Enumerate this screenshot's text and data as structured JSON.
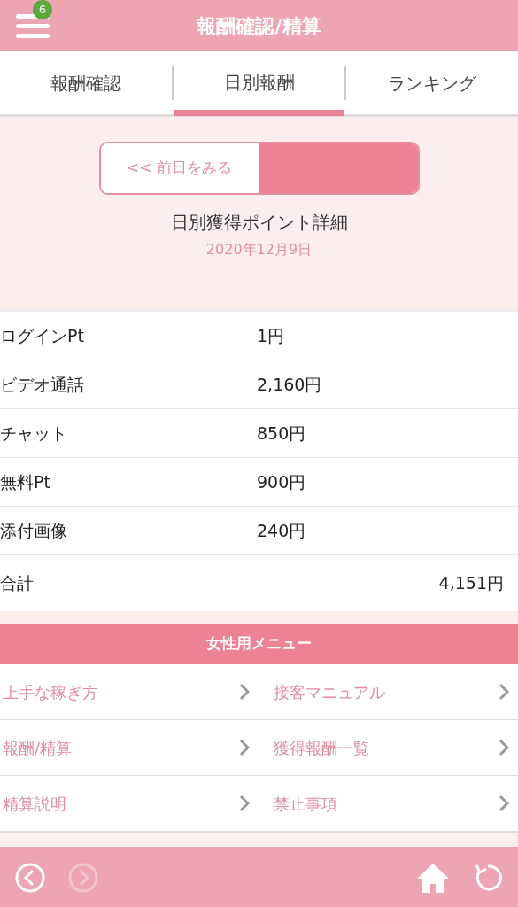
{
  "header": {
    "title": "報酬確認/精算",
    "badge": "6"
  },
  "tabs": [
    {
      "label": "報酬確認",
      "selected": false
    },
    {
      "label": "日別報酬",
      "selected": true
    },
    {
      "label": "ランキング",
      "selected": false
    }
  ],
  "day_nav": {
    "prev_label": "<< 前日をみる",
    "next_disabled": true
  },
  "detail": {
    "title": "日別獲得ポイント詳細",
    "date": "2020年12月9日"
  },
  "rows": [
    {
      "label": "ログインPt",
      "value": "1円",
      "kind": "item"
    },
    {
      "label": "ビデオ通話",
      "value": "2,160円",
      "kind": "item"
    },
    {
      "label": "チャット",
      "value": "850円",
      "kind": "item"
    },
    {
      "label": "無料Pt",
      "value": "900円",
      "kind": "item"
    },
    {
      "label": "添付画像",
      "value": "240円",
      "kind": "item"
    },
    {
      "label": "合計",
      "value": "4,151円",
      "kind": "total"
    }
  ],
  "menu": {
    "title": "女性用メニュー",
    "items": [
      "上手な稼ぎ方",
      "接客マニュアル",
      "報酬/精算",
      "獲得報酬一覧",
      "精算説明",
      "禁止事項"
    ]
  },
  "footer": {
    "back_disabled": false,
    "forward_disabled": true
  }
}
